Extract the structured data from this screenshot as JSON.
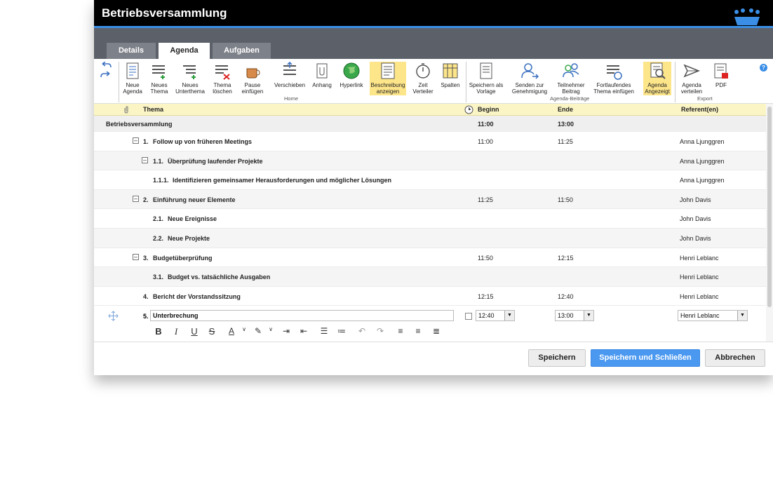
{
  "window": {
    "title": "Betriebsversammlung"
  },
  "tabs": [
    {
      "label": "Details"
    },
    {
      "label": "Agenda"
    },
    {
      "label": "Aufgaben"
    }
  ],
  "ribbon": {
    "new_agenda": "Neue Agenda",
    "new_topic": "Neues Thema",
    "new_subtopic": "Neues Unterthema",
    "delete_topic": "Thema löschen",
    "insert_break": "Pause einfügen",
    "move": "Verschieben",
    "attachment": "Anhang",
    "hyperlink": "Hyperlink",
    "show_description": "Beschreibung anzeigen",
    "time_distributor": "Zeit Verteiler",
    "columns": "Spalten",
    "group_home": "Home",
    "save_as_template": "Speichern als Vorlage",
    "send_for_approval": "Senden zur Genehmigung",
    "participant_contribution": "Teilnehmer Beitrag",
    "insert_continuing_topic": "Fortlaufendes Thema einfügen",
    "agenda_shown": "Agenda Angezeigt",
    "group_agenda_items": "Agenda-Beiträge",
    "distribute_agenda": "Agenda verteilen",
    "pdf": "PDF",
    "group_export": "Export",
    "help": "?"
  },
  "table": {
    "headers": {
      "topic": "Thema",
      "start": "Beginn",
      "end": "Ende",
      "speakers": "Referent(en)"
    },
    "meeting": {
      "title": "Betriebsversammlung",
      "start": "11:00",
      "end": "13:00"
    },
    "rows": [
      {
        "num": "1.",
        "title": "Follow up von früheren Meetings",
        "start": "11:00",
        "end": "11:25",
        "speaker": "Anna Ljunggren"
      },
      {
        "num": "1.1.",
        "title": "Überprüfung laufender Projekte",
        "start": "",
        "end": "",
        "speaker": "Anna Ljunggren"
      },
      {
        "num": "1.1.1.",
        "title": "Identifizieren gemeinsamer Herausforderungen und möglicher Lösungen",
        "start": "",
        "end": "",
        "speaker": "Anna Ljunggren"
      },
      {
        "num": "2.",
        "title": "Einführung neuer Elemente",
        "start": "11:25",
        "end": "11:50",
        "speaker": "John Davis"
      },
      {
        "num": "2.1.",
        "title": "Neue Ereignisse",
        "start": "",
        "end": "",
        "speaker": "John Davis"
      },
      {
        "num": "2.2.",
        "title": "Neue Projekte",
        "start": "",
        "end": "",
        "speaker": "John Davis"
      },
      {
        "num": "3.",
        "title": "Budgetüberprüfung",
        "start": "11:50",
        "end": "12:15",
        "speaker": "Henri Leblanc"
      },
      {
        "num": "3.1.",
        "title": "Budget vs. tatsächliche Ausgaben",
        "start": "",
        "end": "",
        "speaker": "Henri Leblanc"
      },
      {
        "num": "4.",
        "title": "Bericht der Vorstandssitzung",
        "start": "12:15",
        "end": "12:40",
        "speaker": "Henri Leblanc"
      }
    ],
    "edit_row": {
      "num": "5.",
      "title": "Unterbrechung",
      "start": "12:40",
      "end": "13:00",
      "speaker": "Henri Leblanc"
    }
  },
  "footer": {
    "save": "Speichern",
    "save_close": "Speichern und Schließen",
    "cancel": "Abbrechen"
  }
}
